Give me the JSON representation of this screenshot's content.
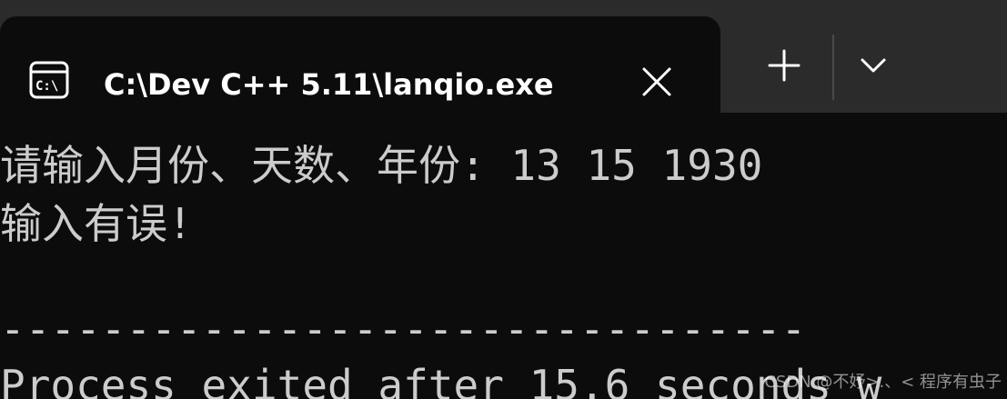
{
  "window": {
    "tab_title": "C:\\Dev C++ 5.11\\lanqio.exe",
    "icon": "console-icon",
    "close_icon": "close-icon",
    "new_tab_icon": "plus-icon",
    "dropdown_icon": "chevron-down-icon"
  },
  "terminal": {
    "lines": [
      "请输入月份、天数、年份: 13 15 1930",
      "输入有误!",
      "",
      "--------------------------------",
      "Process exited after 15.6 seconds w"
    ]
  },
  "watermark": "CSDN @不妤>.、< 程序有虫子",
  "colors": {
    "background": "#0c0c0c",
    "titlebar": "#2b2b2b",
    "text": "#cccccc"
  }
}
